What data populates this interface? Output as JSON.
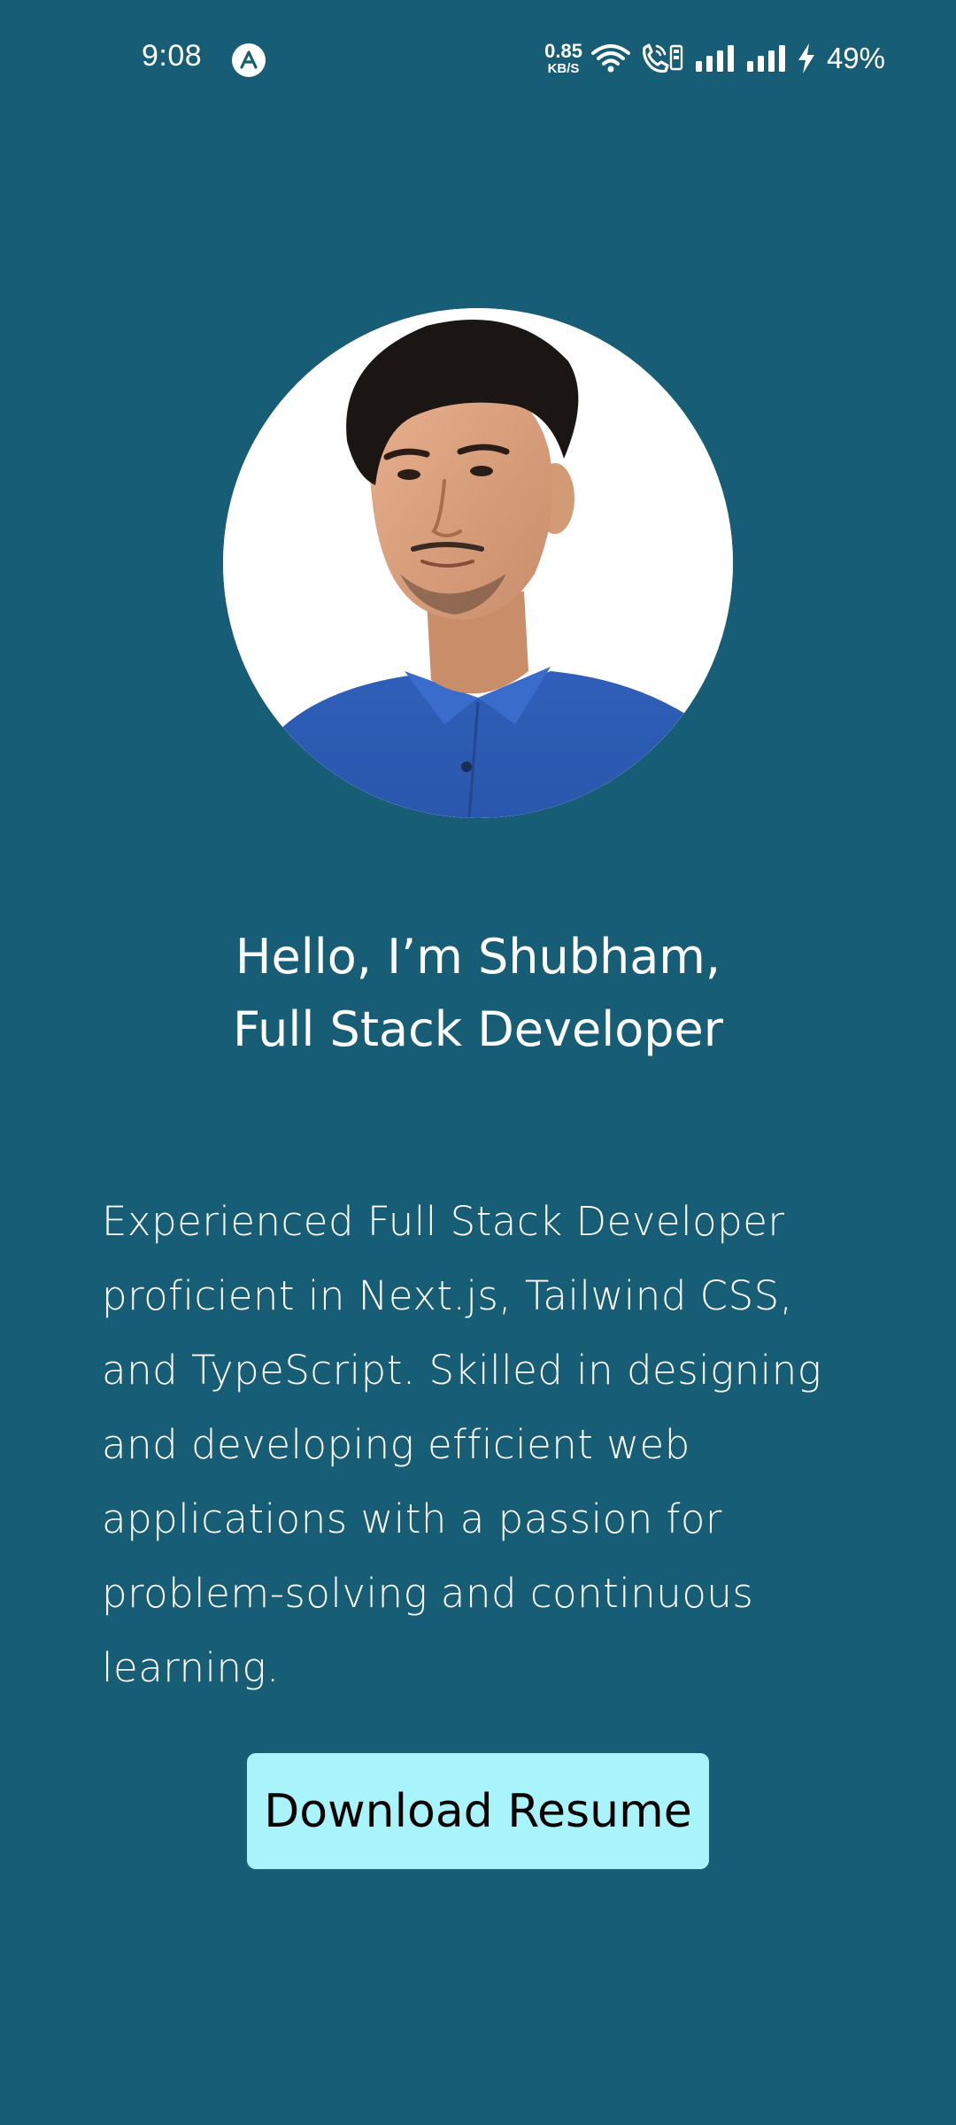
{
  "status_bar": {
    "time": "9:08",
    "notification_icon": "arc-a-icon",
    "net_speed_value": "0.85",
    "net_speed_unit": "KB/S",
    "battery_percent": "49%",
    "icons": [
      "wifi-icon",
      "volte-call-icon",
      "signal-icon",
      "signal-icon",
      "charging-bolt-icon"
    ]
  },
  "profile": {
    "avatar_icon": "profile-photo",
    "headline_line1": "Hello, I’m Shubham,",
    "headline_line2": "Full Stack Developer",
    "description": "Experienced Full Stack Developer proficient in Next.js, Tailwind CSS, and TypeScript. Skilled in designing and developing efficient web applications with a passion for problem-solving and continuous learning."
  },
  "actions": {
    "download_label": "Download Resume"
  },
  "colors": {
    "background": "#175d75",
    "button": "#a9f3fb",
    "text": "#ffffff"
  }
}
